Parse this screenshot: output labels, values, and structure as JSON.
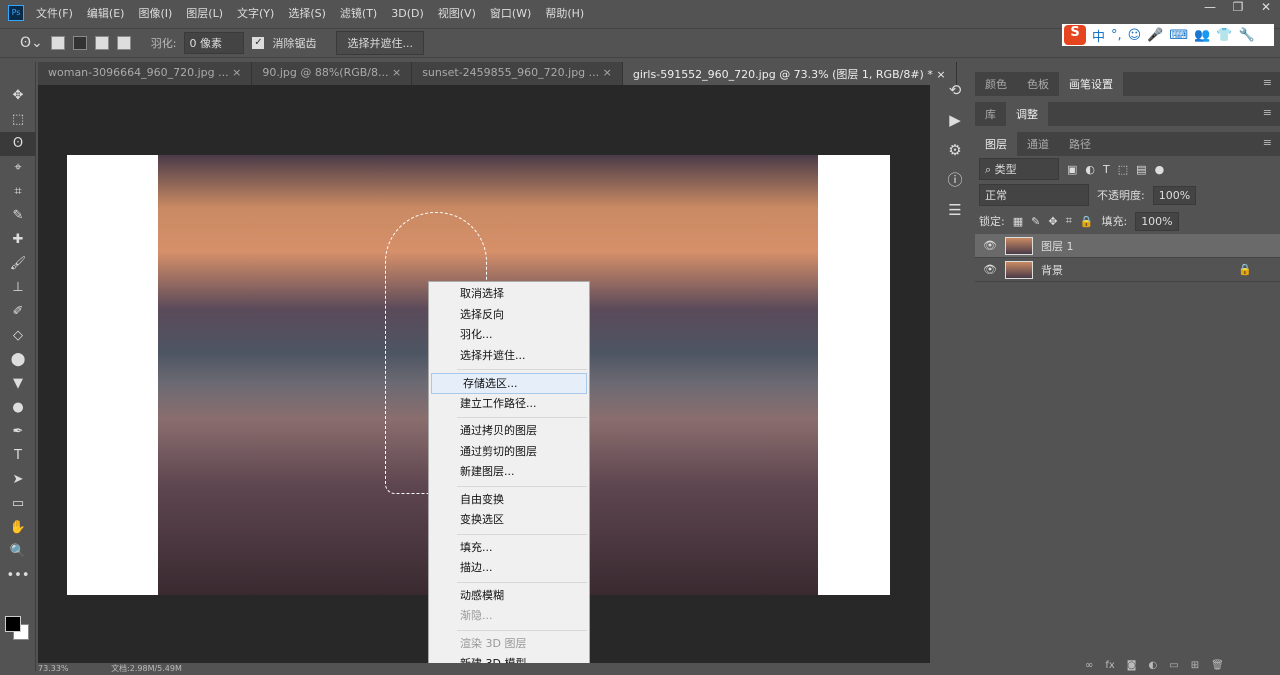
{
  "menubar": {
    "logo": "Ps",
    "items": [
      "文件(F)",
      "编辑(E)",
      "图像(I)",
      "图层(L)",
      "文字(Y)",
      "选择(S)",
      "滤镜(T)",
      "3D(D)",
      "视图(V)",
      "窗口(W)",
      "帮助(H)"
    ],
    "window_controls": [
      "—",
      "❐",
      "✕"
    ]
  },
  "options": {
    "feather_label": "羽化:",
    "feather_value": "0 像素",
    "antialias_label": "消除锯齿",
    "select_mask_button": "选择并遮住..."
  },
  "ime": {
    "logo": "S",
    "items": [
      "中",
      "°,",
      "☺",
      "🎤",
      "⌨",
      "👥",
      "👕",
      "🔧"
    ]
  },
  "tabs": [
    {
      "label": "woman-3096664_960_720.jpg ...",
      "close": "×"
    },
    {
      "label": "90.jpg @ 88%(RGB/8...",
      "close": "×"
    },
    {
      "label": "sunset-2459855_960_720.jpg ...",
      "close": "×"
    },
    {
      "label": "girls-591552_960_720.jpg @ 73.3% (图层 1, RGB/8#) *",
      "close": "×"
    }
  ],
  "tools": [
    "✥",
    "⬚",
    "ʘ",
    "⌖",
    "⌗",
    "✎",
    "✚",
    "🖌",
    "⊥",
    "✐",
    "◇",
    "⬤",
    "▼",
    "●",
    "✒",
    "T",
    "➤",
    "▭",
    "✋",
    "🔍",
    "•••"
  ],
  "context_menu": [
    {
      "label": "取消选择"
    },
    {
      "label": "选择反向"
    },
    {
      "label": "羽化..."
    },
    {
      "label": "选择并遮住..."
    },
    {
      "sep": true
    },
    {
      "label": "存储选区...",
      "highlight": true
    },
    {
      "label": "建立工作路径..."
    },
    {
      "sep": true
    },
    {
      "label": "通过拷贝的图层"
    },
    {
      "label": "通过剪切的图层"
    },
    {
      "label": "新建图层..."
    },
    {
      "sep": true
    },
    {
      "label": "自由变换"
    },
    {
      "label": "变换选区"
    },
    {
      "sep": true
    },
    {
      "label": "填充..."
    },
    {
      "label": "描边..."
    },
    {
      "sep": true
    },
    {
      "label": "动感模糊"
    },
    {
      "label": "渐隐...",
      "disabled": true
    },
    {
      "sep": true
    },
    {
      "label": "渲染 3D 图层",
      "disabled": true
    },
    {
      "label": "新建 3D 模型"
    }
  ],
  "panels": {
    "group1_tabs": [
      "颜色",
      "色板",
      "画笔设置"
    ],
    "group2_tabs": [
      "库",
      "调整"
    ],
    "group3_tabs": [
      "图层",
      "通道",
      "路径"
    ],
    "menu_icon": "≡",
    "filter_kind": "类型",
    "blend_mode": "正常",
    "opacity_label": "不透明度:",
    "opacity_value": "100%",
    "lock_label": "锁定:",
    "fill_label": "填充:",
    "fill_value": "100%",
    "layers": [
      {
        "name": "图层 1",
        "selected": true
      },
      {
        "name": "背景",
        "locked": true
      }
    ]
  },
  "status": {
    "zoom": "73.33%",
    "doc": "文档:2.98M/5.49M"
  }
}
